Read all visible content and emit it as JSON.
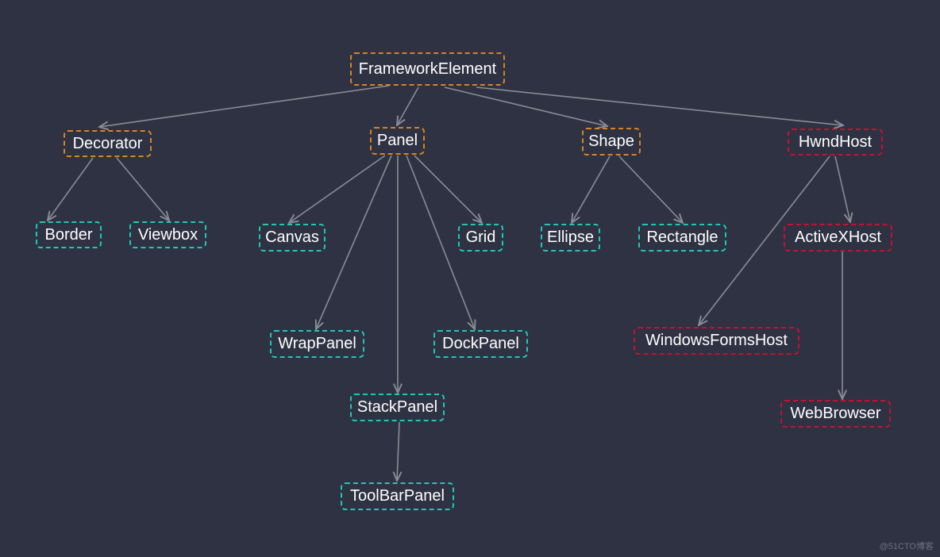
{
  "colors": {
    "background": "#2f3243",
    "edge": "#8a8c94",
    "abstract": "#d9831f",
    "panel_leaf": "#1ec8b4",
    "interop": "#c8102e"
  },
  "nodes": [
    {
      "id": "FrameworkElement",
      "label": "FrameworkElement",
      "group": "abstract"
    },
    {
      "id": "Decorator",
      "label": "Decorator",
      "group": "abstract"
    },
    {
      "id": "Panel",
      "label": "Panel",
      "group": "abstract"
    },
    {
      "id": "Shape",
      "label": "Shape",
      "group": "abstract"
    },
    {
      "id": "HwndHost",
      "label": "HwndHost",
      "group": "interop"
    },
    {
      "id": "Border",
      "label": "Border",
      "group": "panel_leaf"
    },
    {
      "id": "Viewbox",
      "label": "Viewbox",
      "group": "panel_leaf"
    },
    {
      "id": "Canvas",
      "label": "Canvas",
      "group": "panel_leaf"
    },
    {
      "id": "Grid",
      "label": "Grid",
      "group": "panel_leaf"
    },
    {
      "id": "Ellipse",
      "label": "Ellipse",
      "group": "panel_leaf"
    },
    {
      "id": "Rectangle",
      "label": "Rectangle",
      "group": "panel_leaf"
    },
    {
      "id": "ActiveXHost",
      "label": "ActiveXHost",
      "group": "interop"
    },
    {
      "id": "WrapPanel",
      "label": "WrapPanel",
      "group": "panel_leaf"
    },
    {
      "id": "DockPanel",
      "label": "DockPanel",
      "group": "panel_leaf"
    },
    {
      "id": "WindowsFormsHost",
      "label": "WindowsFormsHost",
      "group": "interop"
    },
    {
      "id": "StackPanel",
      "label": "StackPanel",
      "group": "panel_leaf"
    },
    {
      "id": "ToolBarPanel",
      "label": "ToolBarPanel",
      "group": "panel_leaf"
    },
    {
      "id": "WebBrowser",
      "label": "WebBrowser",
      "group": "interop"
    }
  ],
  "edges": [
    [
      "FrameworkElement",
      "Decorator"
    ],
    [
      "FrameworkElement",
      "Panel"
    ],
    [
      "FrameworkElement",
      "Shape"
    ],
    [
      "FrameworkElement",
      "HwndHost"
    ],
    [
      "Decorator",
      "Border"
    ],
    [
      "Decorator",
      "Viewbox"
    ],
    [
      "Panel",
      "Canvas"
    ],
    [
      "Panel",
      "WrapPanel"
    ],
    [
      "Panel",
      "StackPanel"
    ],
    [
      "Panel",
      "DockPanel"
    ],
    [
      "Panel",
      "Grid"
    ],
    [
      "Shape",
      "Ellipse"
    ],
    [
      "Shape",
      "Rectangle"
    ],
    [
      "HwndHost",
      "WindowsFormsHost"
    ],
    [
      "HwndHost",
      "ActiveXHost"
    ],
    [
      "ActiveXHost",
      "WebBrowser"
    ],
    [
      "StackPanel",
      "ToolBarPanel"
    ]
  ],
  "watermark": "@51CTO博客"
}
